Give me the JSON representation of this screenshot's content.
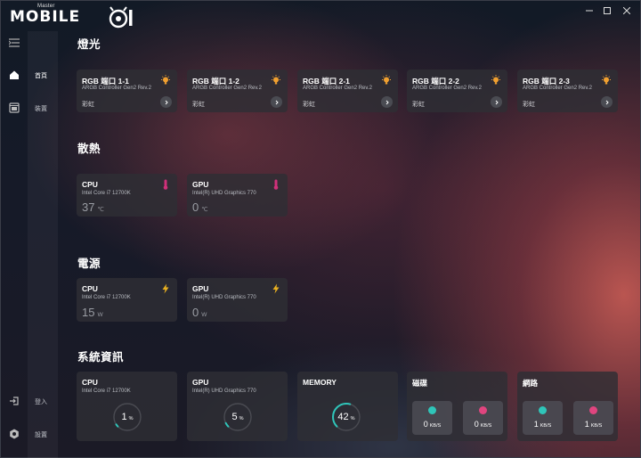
{
  "app": {
    "logo_small": "Master",
    "logo_word": "MOBILE"
  },
  "sidebar": {
    "menu": [
      {
        "label": "首頁",
        "active": true
      },
      {
        "label": "裝置",
        "active": false
      },
      {
        "label": "登入",
        "active": false
      },
      {
        "label": "設置",
        "active": false
      }
    ]
  },
  "sections": {
    "lighting": "燈光",
    "cooling": "散熱",
    "power": "電源",
    "sysinfo": "系統資訊"
  },
  "lighting_cards": [
    {
      "title": "RGB 端口 1-1",
      "subtitle": "ARGB Controller Gen2 Rev.2",
      "mode": "彩虹",
      "icon": "bulb-icon"
    },
    {
      "title": "RGB 端口 1-2",
      "subtitle": "ARGB Controller Gen2 Rev.2",
      "mode": "彩虹",
      "icon": "bulb-icon"
    },
    {
      "title": "RGB 端口 2-1",
      "subtitle": "ARGB Controller Gen2 Rev.2",
      "mode": "彩虹",
      "icon": "bulb-icon"
    },
    {
      "title": "RGB 端口 2-2",
      "subtitle": "ARGB Controller Gen2 Rev.2",
      "mode": "彩虹",
      "icon": "bulb-icon"
    },
    {
      "title": "RGB 端口 2-3",
      "subtitle": "ARGB Controller Gen2 Rev.2",
      "mode": "彩虹",
      "icon": "bulb-icon"
    }
  ],
  "cooling_cards": [
    {
      "title": "CPU",
      "subtitle": "Intel Core i7 12700K",
      "value": "37",
      "unit": "℃",
      "icon": "thermometer-icon"
    },
    {
      "title": "GPU",
      "subtitle": "Intel(R) UHD Graphics 770",
      "value": "0",
      "unit": "℃",
      "icon": "thermometer-icon"
    }
  ],
  "power_cards": [
    {
      "title": "CPU",
      "subtitle": "Intel Core i7 12700K",
      "value": "15",
      "unit": "W",
      "icon": "lightning-icon"
    },
    {
      "title": "GPU",
      "subtitle": "Intel(R) UHD Graphics 770",
      "value": "0",
      "unit": "W",
      "icon": "lightning-icon"
    }
  ],
  "sysinfo_cards": {
    "cpu": {
      "title": "CPU",
      "subtitle": "Intel Core i7 12700K",
      "value": "1",
      "unit": "%",
      "fraction": 0.01
    },
    "gpu": {
      "title": "GPU",
      "subtitle": "Intel(R) UHD Graphics 770",
      "value": "5",
      "unit": "%",
      "fraction": 0.05
    },
    "memory": {
      "title": "MEMORY",
      "value": "42",
      "unit": "%",
      "fraction": 0.42
    },
    "disk": {
      "title": "磁碟",
      "read": "0",
      "write": "0",
      "unit": "KB/S"
    },
    "network": {
      "title": "網路",
      "upload": "1",
      "download": "1",
      "unit": "KB/S"
    }
  },
  "colors": {
    "accent_teal": "#2fc5b9",
    "accent_pink": "#e0457f",
    "bulb": "#f0a030",
    "thermometer": "#d0307a",
    "lightning": "#e8b020"
  }
}
